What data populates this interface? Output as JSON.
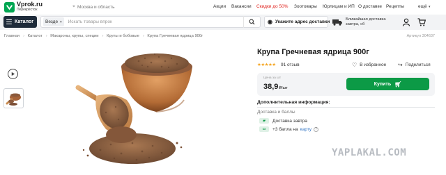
{
  "header": {
    "logo_name": "Vprok.ru",
    "logo_sub": "Перекрёсток",
    "city": "Москва и область",
    "links": [
      "Акции",
      "Вакансии",
      "Скидки до 50%",
      "Зоотовары",
      "Юрлицам и ИП",
      "О доставке",
      "Рецепты",
      "ещё"
    ],
    "sale_color": "#e0201b"
  },
  "nav": {
    "catalog_label": "Каталог",
    "search_scope": "Везде",
    "search_placeholder": "Искать товары впрок",
    "address_label": "Укажите адрес доставки",
    "delivery_line1": "Ближайшая доставка",
    "delivery_line2": "завтра, сб"
  },
  "breadcrumb": [
    "Главная",
    "Каталог",
    "Макароны, крупы, специи",
    "Крупы и бобовые",
    "Крупа Гречневая ядрица 900г"
  ],
  "sku": "Артикул 304637",
  "product": {
    "title": "Крупа Гречневая ядрица 900г",
    "stars": "★★★★★",
    "reviews": "91 отзыв",
    "favorite_label": "В избранное",
    "share_label": "Поделиться",
    "price_label": "Цена за шт",
    "price_main": "38,9",
    "price_unit": "₽/шт",
    "buy_label": "Купить",
    "accent": "#0c9a46"
  },
  "extra": {
    "title": "Дополнительная информация:",
    "delivery_title": "Доставка и баллы",
    "delivery_row": "Доставка завтра",
    "points_row": "+3 балла на",
    "points_link": "карту"
  },
  "watermark": "YAPLAKAL.COM"
}
